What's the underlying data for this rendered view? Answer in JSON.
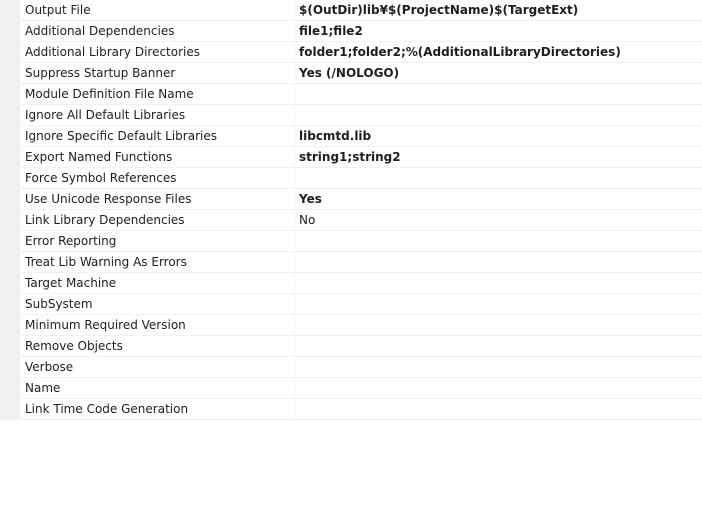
{
  "properties": [
    {
      "name": "Output File",
      "value": "$(OutDir)lib¥$(ProjectName)$(TargetExt)",
      "bold": true
    },
    {
      "name": "Additional Dependencies",
      "value": "file1;file2",
      "bold": true
    },
    {
      "name": "Additional Library Directories",
      "value": "folder1;folder2;%(AdditionalLibraryDirectories)",
      "bold": true
    },
    {
      "name": "Suppress Startup Banner",
      "value": "Yes (/NOLOGO)",
      "bold": true
    },
    {
      "name": "Module Definition File Name",
      "value": "",
      "bold": false
    },
    {
      "name": "Ignore All Default Libraries",
      "value": "",
      "bold": false
    },
    {
      "name": "Ignore Specific Default Libraries",
      "value": "libcmtd.lib",
      "bold": true
    },
    {
      "name": "Export Named Functions",
      "value": "string1;string2",
      "bold": true
    },
    {
      "name": "Force Symbol References",
      "value": "",
      "bold": false
    },
    {
      "name": "Use Unicode Response Files",
      "value": "Yes",
      "bold": true
    },
    {
      "name": "Link Library Dependencies",
      "value": "No",
      "bold": false
    },
    {
      "name": "Error Reporting",
      "value": "",
      "bold": false
    },
    {
      "name": "Treat Lib Warning As Errors",
      "value": "",
      "bold": false
    },
    {
      "name": "Target Machine",
      "value": "",
      "bold": false
    },
    {
      "name": "SubSystem",
      "value": "",
      "bold": false
    },
    {
      "name": "Minimum Required Version",
      "value": "",
      "bold": false
    },
    {
      "name": "Remove Objects",
      "value": "",
      "bold": false
    },
    {
      "name": "Verbose",
      "value": "",
      "bold": false
    },
    {
      "name": "Name",
      "value": "",
      "bold": false
    },
    {
      "name": "Link Time Code Generation",
      "value": "",
      "bold": false
    }
  ]
}
